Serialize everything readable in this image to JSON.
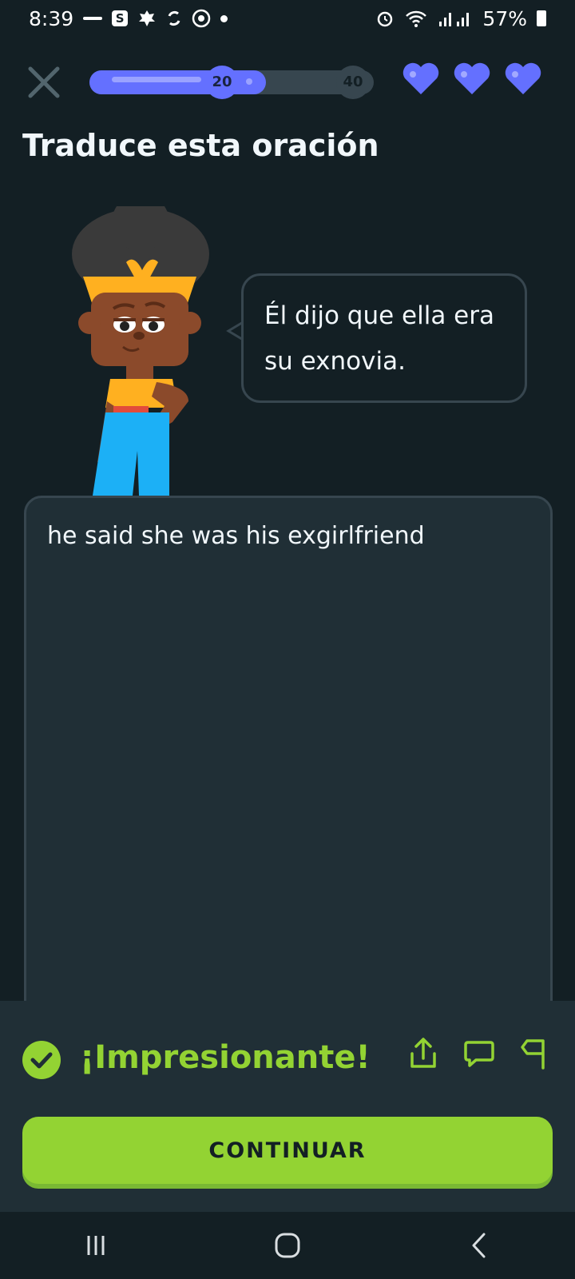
{
  "status_bar": {
    "time": "8:39",
    "battery": "57%",
    "icons": [
      "notification-icon",
      "s-app-icon",
      "leaf-icon",
      "sync-icon",
      "target-icon",
      "alarm-icon",
      "wifi-icon",
      "signal-icon",
      "battery-icon"
    ]
  },
  "lesson": {
    "progress_fraction": 0.62,
    "milestones": [
      {
        "label": "20",
        "reached": true
      },
      {
        "label": "40",
        "reached": false
      }
    ],
    "hearts_count": 3,
    "accent_color": "#6470ff"
  },
  "page": {
    "title": "Traduce esta oración"
  },
  "prompt": {
    "sentence_line1": "Él dijo que ella era",
    "sentence_line2": "su exnovia."
  },
  "answer": {
    "text": "he said she was his exgirlfriend"
  },
  "feedback": {
    "title": "¡Impresionante!",
    "color": "#93d333",
    "continue_label": "CONTINUAR"
  },
  "nav": {
    "icons": [
      "recent-apps-icon",
      "home-icon",
      "back-icon"
    ]
  }
}
